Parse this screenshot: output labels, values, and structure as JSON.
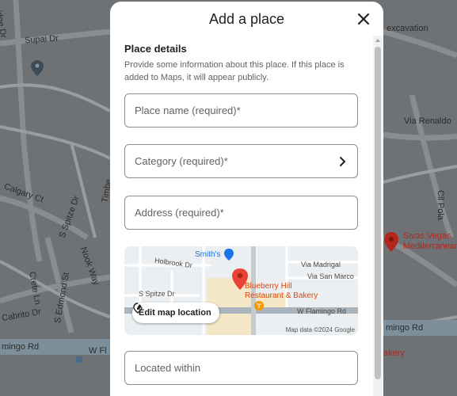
{
  "dialog": {
    "title": "Add a place",
    "section_title": "Place details",
    "section_desc": "Provide some information about this place. If this place is added to Maps, it will appear publicly."
  },
  "fields": {
    "place_name": "Place name (required)*",
    "category": "Category (required)*",
    "address": "Address (required)*",
    "located_within": "Located within"
  },
  "mini_map": {
    "edit_label": "Edit map location",
    "attribution": "Map data ©2024 Google",
    "labels": {
      "smiths": "Smith's",
      "holbrook": "Holbrook Dr",
      "spitze": "S Spitze Dr",
      "madrigal": "Via Madrigal",
      "sanmarco": "Via San Marco",
      "blueberry1": "Blueberry Hill",
      "blueberry2": "Restaurant & Bakery",
      "flamingo": "W Flamingo Rd"
    }
  },
  "background": {
    "labels": {
      "supai": "Supai Dr",
      "ridge": "idge Dr",
      "excavation": "excavation",
      "renaldo": "Via Renaldo",
      "cil": "Cil Pola",
      "calgary": "Calgary Ct",
      "spitze": "S Spitze Dr",
      "timber": "Timbe",
      "crete": "Crete Ln",
      "nook": "Nook Way",
      "cabrito": "Cabrito Dr",
      "edmond": "S Edmond St",
      "sivas1": "Sivas Vegas",
      "sivas2": "Mediterranean",
      "mingo": "mingo Rd",
      "wfl": "W Fl",
      "mingo_right": "mingo Rd",
      "bakery": "akery"
    }
  },
  "colors": {
    "accent_red": "#ea4335",
    "dark_pin": "#b3261e"
  }
}
